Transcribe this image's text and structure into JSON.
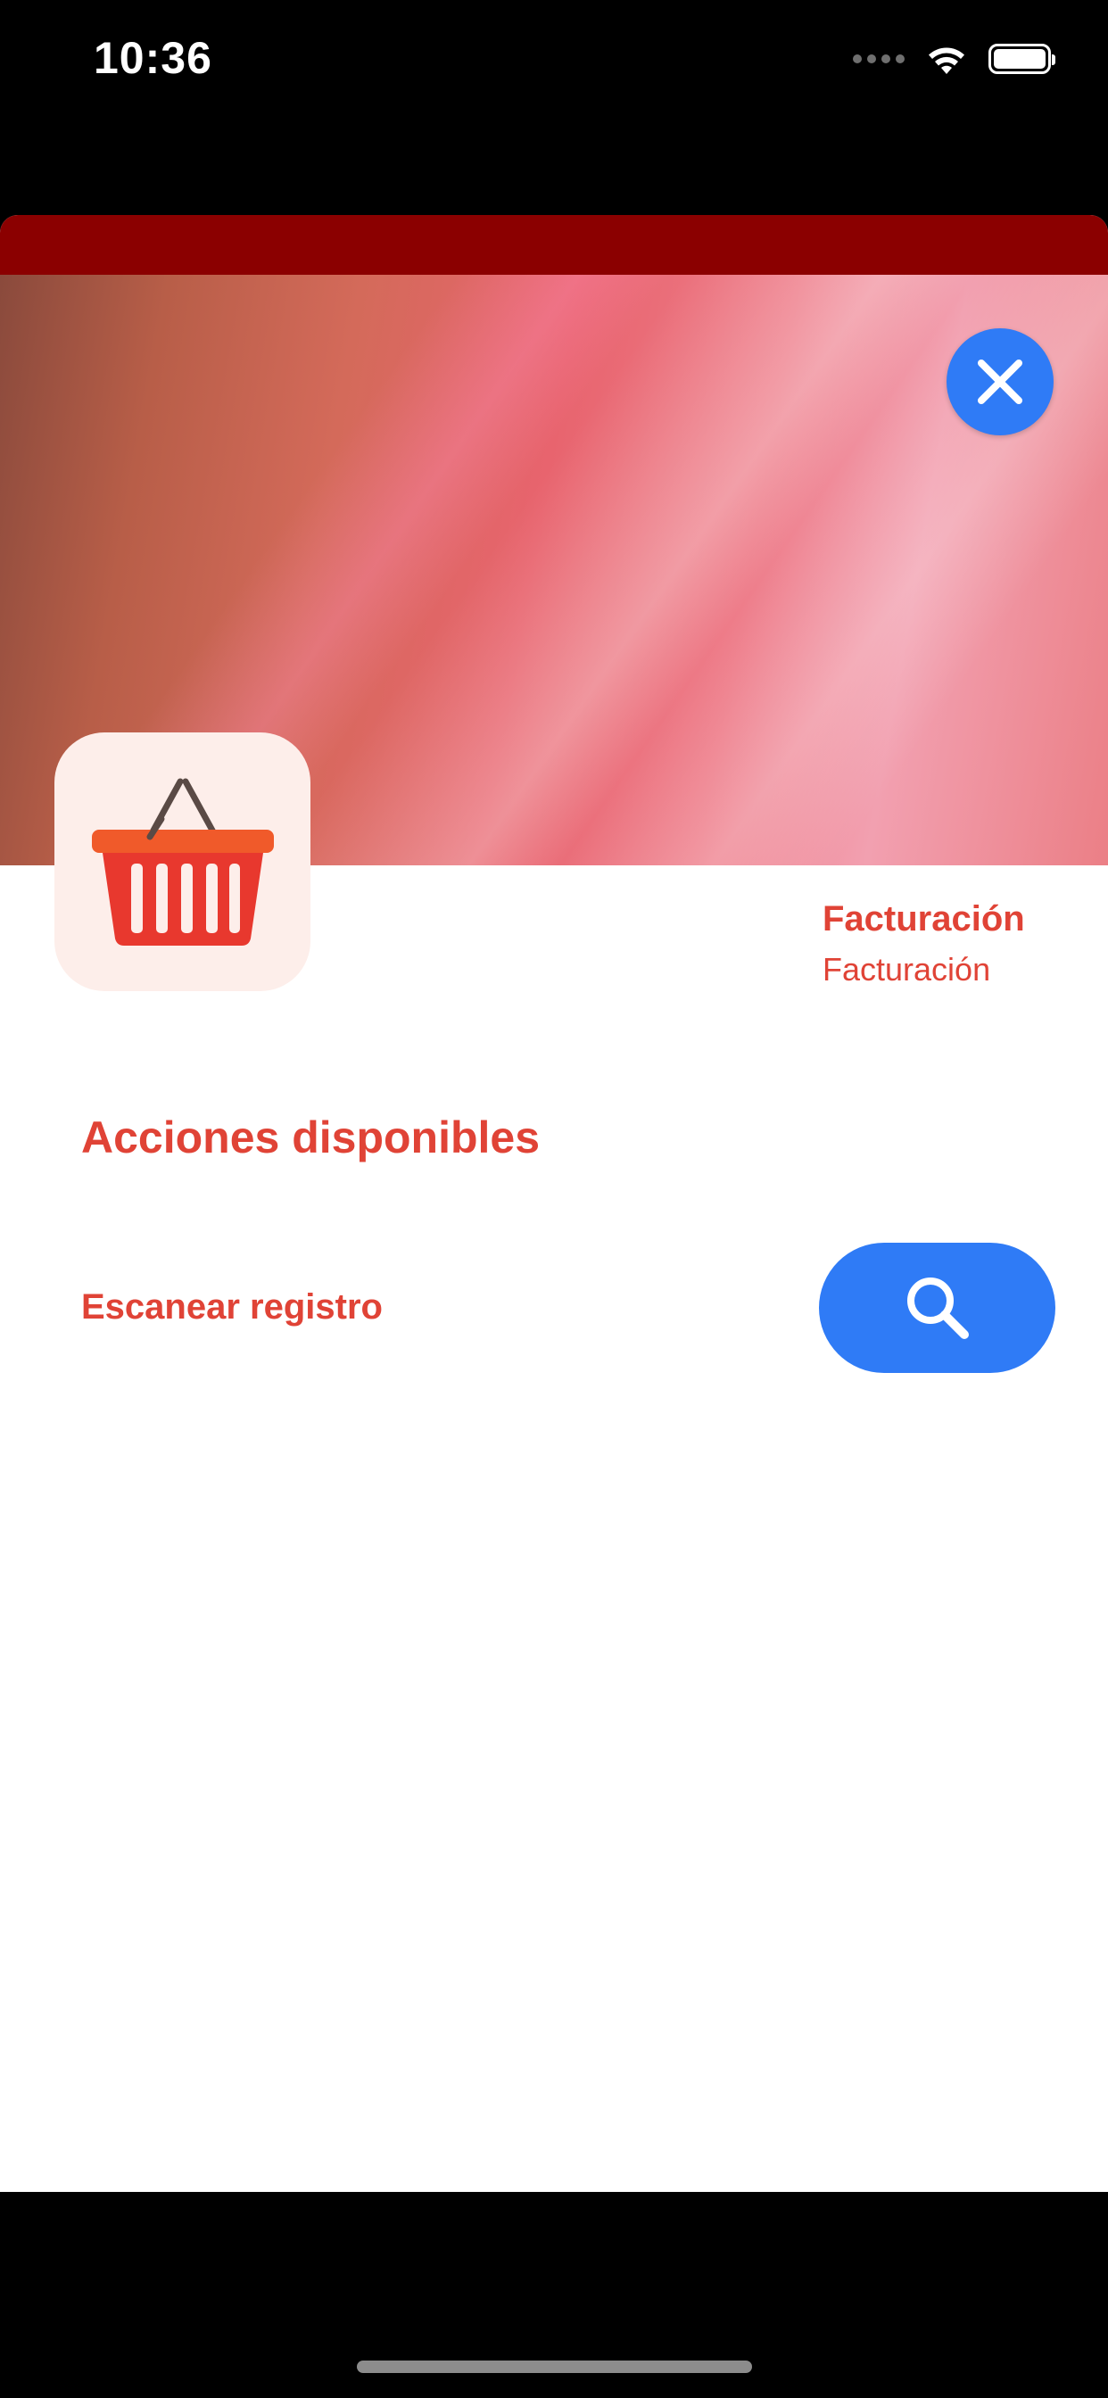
{
  "status_bar": {
    "time": "10:36",
    "icons": [
      "signal-icon",
      "wifi-icon",
      "battery-icon"
    ]
  },
  "hero": {
    "close_icon": "close-icon"
  },
  "app_header": {
    "icon": "shopping-basket-icon",
    "title": "Facturación",
    "subtitle": "Facturación"
  },
  "actions_section": {
    "title": "Acciones disponibles",
    "items": [
      {
        "label": "Escanear registro",
        "button_icon": "search-icon"
      }
    ]
  },
  "colors": {
    "accent_red": "#e04336",
    "header_bar": "#8b0000",
    "button_blue": "#2f7bf6",
    "icon_tile_bg": "#fdeeea"
  }
}
